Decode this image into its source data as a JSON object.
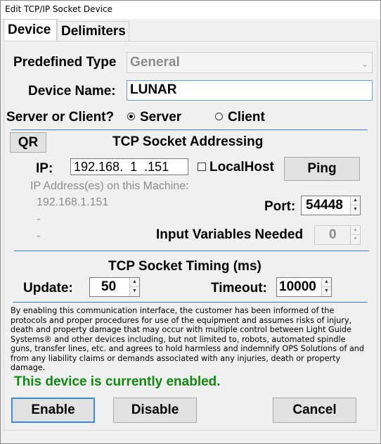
{
  "window": {
    "title": "Edit TCP/IP Socket Device"
  },
  "tabs": [
    {
      "label": "Device"
    },
    {
      "label": "Delimiters"
    }
  ],
  "device": {
    "predefined_type_label": "Predefined Type",
    "predefined_type_value": "General",
    "device_name_label": "Device Name:",
    "device_name_value": "LUNAR",
    "mode_label": "Server or Client?",
    "mode_options": [
      "Server",
      "Client"
    ],
    "mode_selected": "Server"
  },
  "addressing": {
    "qr_label": "QR",
    "heading": "TCP Socket Addressing",
    "ip_label": "IP:",
    "ip_value": "192.168.  1  .151",
    "localhost_label": "LocalHost",
    "localhost_checked": false,
    "ping_label": "Ping",
    "machine_ips_label": "IP Address(es) on this Machine:",
    "machine_ips": [
      "192.168.1.151",
      "-",
      "-"
    ],
    "port_label": "Port:",
    "port_value": "54448",
    "input_vars_label": "Input Variables Needed",
    "input_vars_value": "0"
  },
  "timing": {
    "heading": "TCP Socket Timing (ms)",
    "update_label": "Update:",
    "update_value": "50",
    "timeout_label": "Timeout:",
    "timeout_value": "10000"
  },
  "disclaimer": "By enabling this communication interface, the customer has been informed of the protocols and proper procedures for use of the equipment and assumes risks of injury, death and property damage that may occur with multiple control between Light Guide Systems® and other devices including, but not limited to, robots, automated spindle guns, transfer lines, etc. and agrees to hold harmless and indemnify OPS Solutions of and from any liability claims or demands associated with any injuries, death or property damage.",
  "status_message": "This device is currently enabled.",
  "status_color": "#108a10",
  "accent_color": "#3c7fc4",
  "buttons": {
    "enable": "Enable",
    "disable": "Disable",
    "cancel": "Cancel"
  }
}
